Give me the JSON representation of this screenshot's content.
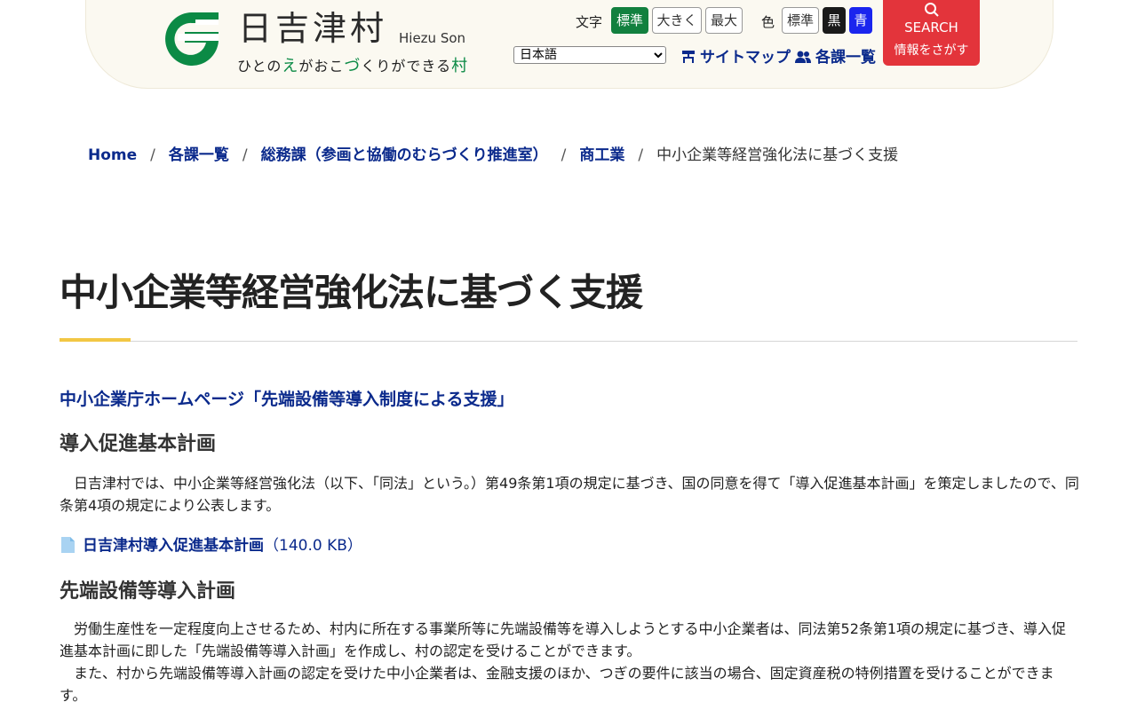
{
  "header": {
    "site_name": "日吉津村",
    "site_name_roman": "Hiezu Son",
    "tagline": {
      "p1": "ひとの",
      "hl1": "え",
      "p2": "がおこ",
      "hl2": "づ",
      "p3": "くりができる",
      "hl3": "村"
    },
    "font_size": {
      "label": "文字",
      "standard": "標準",
      "large": "大きく",
      "max": "最大"
    },
    "color": {
      "label": "色",
      "standard": "標準",
      "black": "黒",
      "blue": "青"
    },
    "language": "日本語",
    "sitemap": "サイトマップ",
    "departments": "各課一覧",
    "search": {
      "label": "SEARCH",
      "sub": "情報をさがす"
    }
  },
  "breadcrumb": {
    "home": "Home",
    "dept_list": "各課一覧",
    "dept": "総務課（参画と協働のむらづくり推進室）",
    "section": "商工業",
    "current": "中小企業等経営強化法に基づく支援"
  },
  "main": {
    "title": "中小企業等経営強化法に基づく支援",
    "ext_link": "中小企業庁ホームページ「先端設備等導入制度による支援」",
    "h2_1": "導入促進基本計画",
    "p1": "　日吉津村では、中小企業等経営強化法（以下、「同法」という。）第49条第1項の規定に基づき、国の同意を得て「導入促進基本計画」を策定しましたので、同条第4項の規定により公表します。",
    "file_link": "日吉津村導入促進基本計画",
    "file_size": "（140.0 KB）",
    "h2_2": "先端設備等導入計画",
    "p2": "　労働生産性を一定程度向上させるため、村内に所在する事業所等に先端設備等を導入しようとする中小企業者は、同法第52条第1項の規定に基づき、導入促進基本計画に即した「先端設備等導入計画」を作成し、村の認定を受けることができます。",
    "p3": "　また、村から先端設備等導入計画の認定を受けた中小企業者は、金融支援のほか、つぎの要件に該当の場合、固定資産税の特例措置を受けることができます。"
  },
  "colors": {
    "brand_green": "#0b8a45",
    "link_navy": "#0b2a8c",
    "search_red": "#e3343b",
    "accent_yellow": "#f2c744"
  }
}
